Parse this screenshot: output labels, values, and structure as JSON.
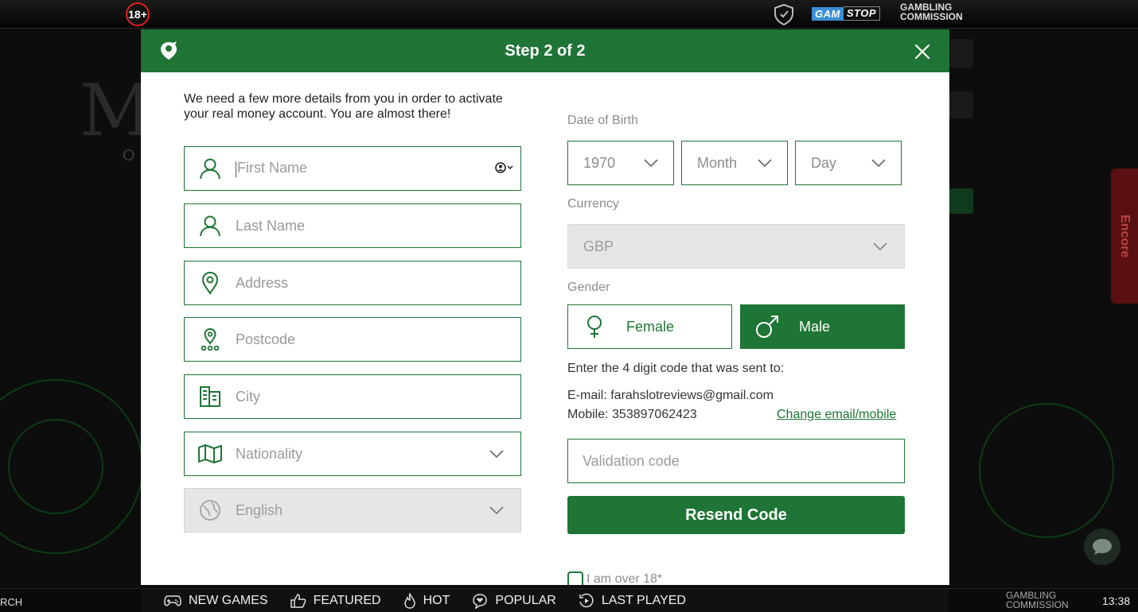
{
  "top_bar": {
    "age_badge": "18+",
    "gamstop_gam": "GAM",
    "gamstop_stop": "STOP",
    "gambling_commission_line1": "GAMBLING",
    "gambling_commission_line2": "COMMISSION"
  },
  "background": {
    "side_tab": "Encore"
  },
  "modal": {
    "title": "Step 2 of 2",
    "intro": "We need a few more details from you in order to activate your real money account. You are almost there!",
    "left_fields": {
      "first_name_placeholder": "First Name",
      "last_name_placeholder": "Last Name",
      "address_placeholder": "Address",
      "postcode_placeholder": "Postcode",
      "city_placeholder": "City",
      "nationality_placeholder": "Nationality",
      "language_value": "English"
    },
    "date_of_birth": {
      "label": "Date of Birth",
      "year": "1970",
      "month": "Month",
      "day": "Day"
    },
    "currency": {
      "label": "Currency",
      "value": "GBP"
    },
    "gender": {
      "label": "Gender",
      "female": "Female",
      "male": "Male",
      "selected": "Male"
    },
    "verification": {
      "instruction": "Enter the 4 digit code that was sent to:",
      "email_line": "E-mail: farahslotreviews@gmail.com",
      "mobile_line": "Mobile: 353897062423",
      "change_link": "Change email/mobile",
      "validation_placeholder": "Validation code",
      "resend_button": "Resend Code"
    },
    "age_checkbox": "I am over 18*"
  },
  "bottom_bar": {
    "search_fragment": "RCH",
    "nav": [
      "NEW GAMES",
      "FEATURED",
      "HOT",
      "POPULAR",
      "LAST PLAYED"
    ],
    "gambling_commission_line1": "GAMBLING",
    "gambling_commission_line2": "COMMISSION",
    "clock": "13:38"
  },
  "colors": {
    "brand_green": "#1e7535",
    "disabled_grey": "#e6e6e6",
    "label_grey": "#8c8c8c"
  }
}
